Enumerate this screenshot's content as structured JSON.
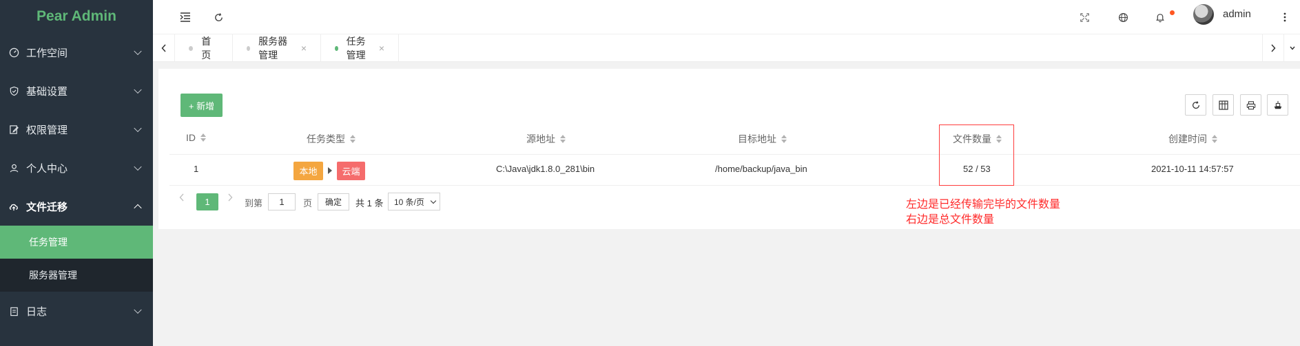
{
  "app": {
    "logo": "Pear Admin"
  },
  "sidebar": {
    "items": [
      {
        "label": "工作空间"
      },
      {
        "label": "基础设置"
      },
      {
        "label": "权限管理"
      },
      {
        "label": "个人中心"
      },
      {
        "label": "文件迁移"
      },
      {
        "label": "日志"
      }
    ],
    "sub_items": [
      {
        "label": "任务管理"
      },
      {
        "label": "服务器管理"
      }
    ]
  },
  "header": {
    "username": "admin"
  },
  "tabs": [
    {
      "label": "首页"
    },
    {
      "label": "服务器管理",
      "close": "×"
    },
    {
      "label": "任务管理",
      "close": "×"
    }
  ],
  "toolbar": {
    "add_label": "+ 新增"
  },
  "table": {
    "columns": [
      "ID",
      "任务类型",
      "源地址",
      "目标地址",
      "文件数量",
      "创建时间"
    ],
    "rows": [
      {
        "id": "1",
        "type_from": "本地",
        "type_to": "云端",
        "source": "C:\\Java\\jdk1.8.0_281\\bin",
        "target": "/home/backup/java_bin",
        "file_count": "52 / 53",
        "created": "2021-10-11 14:57:57"
      }
    ]
  },
  "pager": {
    "current": "1",
    "goto_label": "到第",
    "goto_value": "1",
    "page_label": "页",
    "confirm_label": "确定",
    "total_label": "共 1 条",
    "page_size": "10 条/页"
  },
  "annotation": {
    "line1": "左边是已经传输完毕的文件数量",
    "line2": "右边是总文件数量"
  },
  "colors": {
    "accent": "#5fb878",
    "sidebar_bg": "#28333e",
    "badge_orange": "#f4a640",
    "badge_red": "#f56c6c",
    "annotation": "#ff2a2a"
  }
}
